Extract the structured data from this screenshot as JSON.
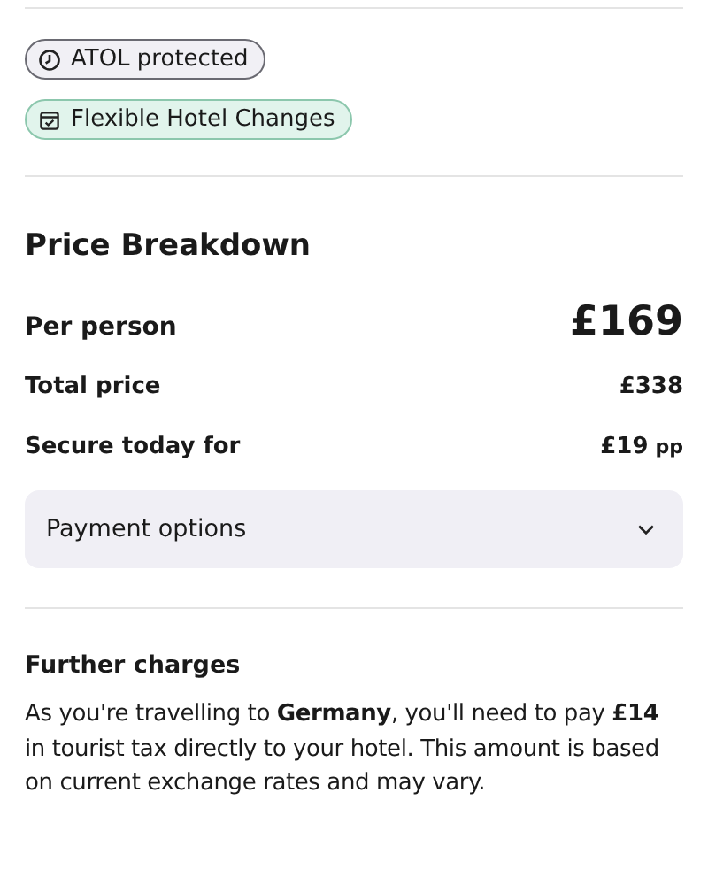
{
  "badges": [
    {
      "kind": "atol",
      "label": "ATOL protected"
    },
    {
      "kind": "flex",
      "label": "Flexible Hotel Changes"
    }
  ],
  "price_breakdown": {
    "title": "Price Breakdown",
    "rows": [
      {
        "kind": "main",
        "label": "Per person",
        "value": "£169"
      },
      {
        "kind": "normal",
        "label": "Total price",
        "value": "£338"
      },
      {
        "kind": "normal",
        "label": "Secure today for",
        "value": "£19",
        "unit": "pp"
      }
    ]
  },
  "payment_options": {
    "label": "Payment options",
    "expanded": false
  },
  "further_charges": {
    "title": "Further charges",
    "text": "As you're travelling to **Germany**, you'll need to pay **£14** in tourist tax directly to your hotel. This amount is based on current exchange rates and may vary."
  }
}
